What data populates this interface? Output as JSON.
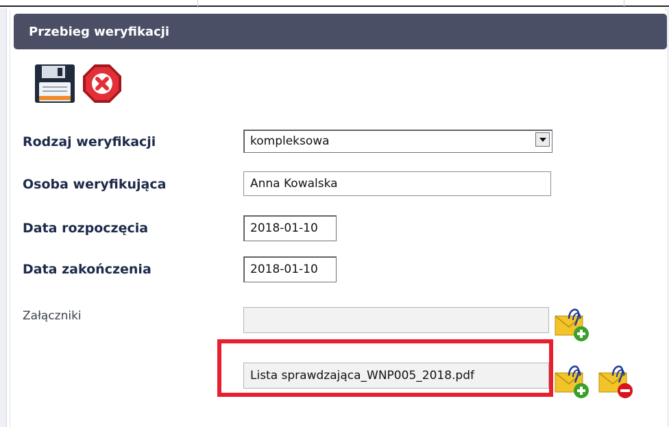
{
  "panel": {
    "title": "Przebieg weryfikacji"
  },
  "toolbar": {
    "save_icon": "floppy-disk-icon",
    "cancel_icon": "stop-x-icon"
  },
  "form": {
    "verification_type": {
      "label": "Rodzaj weryfikacji",
      "value": "kompleksowa"
    },
    "verifier": {
      "label": "Osoba weryfikująca",
      "value": "Anna Kowalska"
    },
    "start_date": {
      "label": "Data rozpoczęcia",
      "value": "2018-01-10"
    },
    "end_date": {
      "label": "Data zakończenia",
      "value": "2018-01-10"
    },
    "attachments": {
      "label": "Załączniki",
      "items": [
        "",
        "Lista sprawdzająca_WNP005_2018.pdf"
      ]
    }
  },
  "colors": {
    "header_bg": "#4b4f66",
    "highlight": "#e8202e",
    "label_text": "#1c2a4a"
  }
}
